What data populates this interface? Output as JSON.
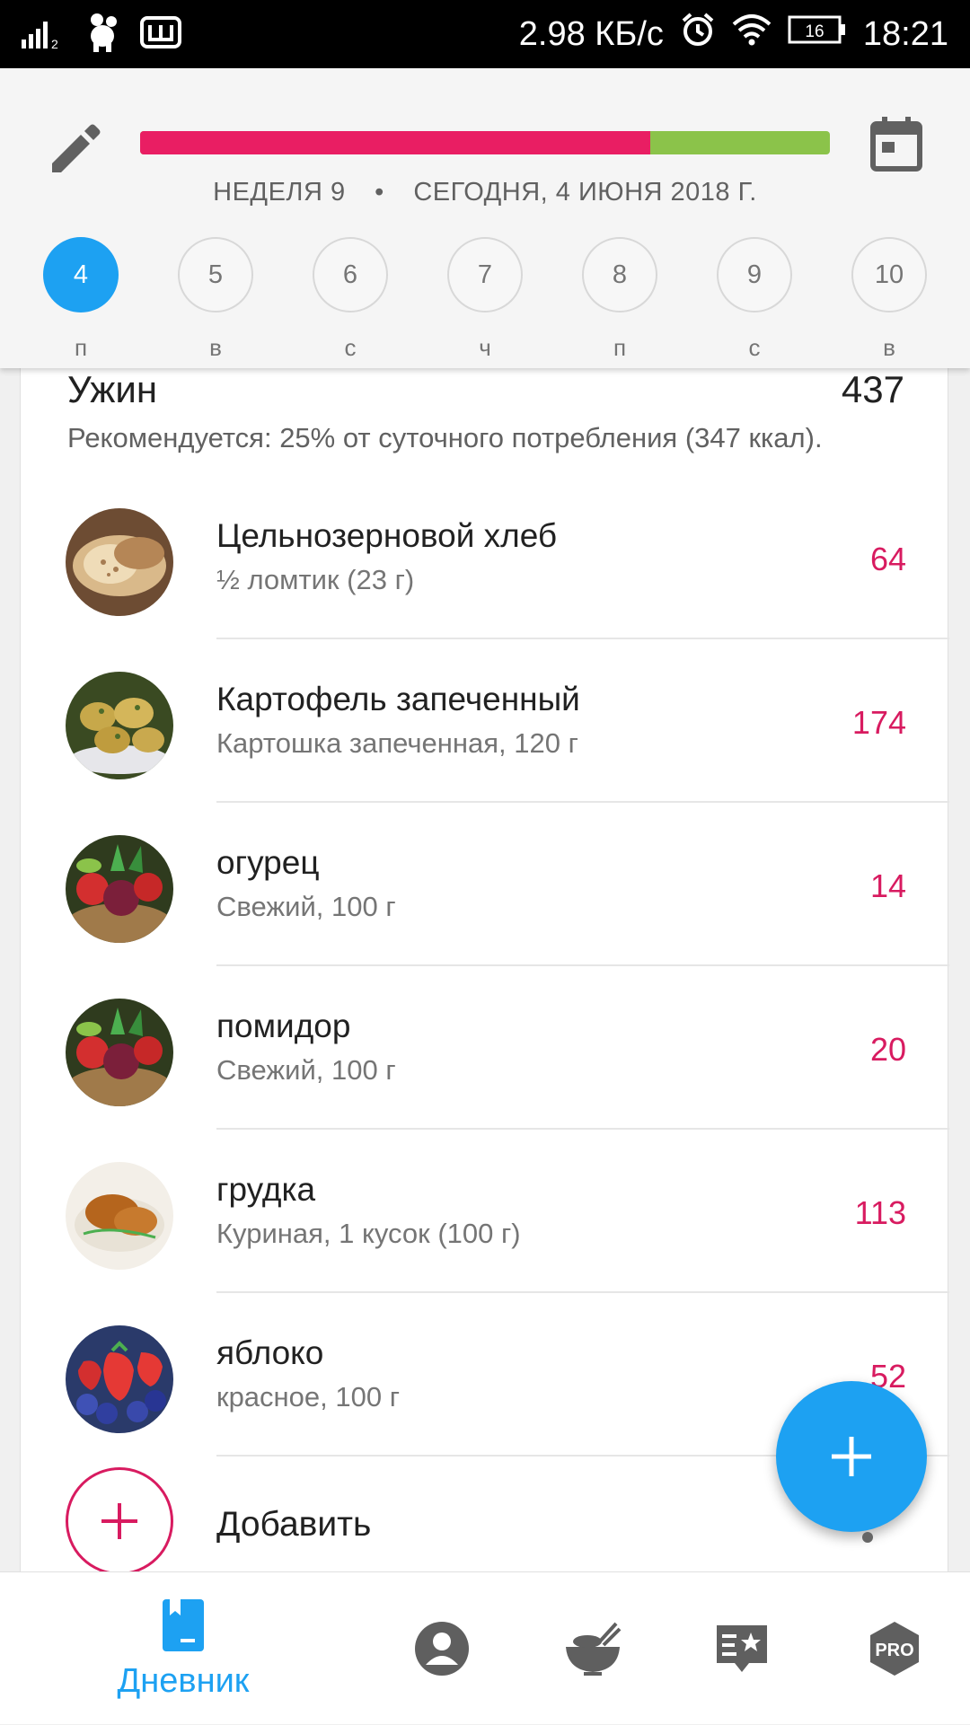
{
  "status_bar": {
    "net_speed": "2.98 КБ/с",
    "battery": "16",
    "time": "18:21",
    "sim_label": "2"
  },
  "header": {
    "progress_fraction": 0.74,
    "week_label": "НЕДЕЛЯ 9",
    "separator": "•",
    "date_label": "СЕГОДНЯ, 4 ИЮНЯ 2018 Г.",
    "days": [
      {
        "num": "4",
        "wd": "п",
        "active": true
      },
      {
        "num": "5",
        "wd": "в",
        "active": false
      },
      {
        "num": "6",
        "wd": "с",
        "active": false
      },
      {
        "num": "7",
        "wd": "ч",
        "active": false
      },
      {
        "num": "8",
        "wd": "п",
        "active": false
      },
      {
        "num": "9",
        "wd": "с",
        "active": false
      },
      {
        "num": "10",
        "wd": "в",
        "active": false
      }
    ]
  },
  "meal": {
    "title": "Ужин",
    "total": "437",
    "recommendation": "Рекомендуется: 25% от суточного потребления (347 ккал).",
    "items": [
      {
        "name": "Цельнозерновой хлеб",
        "desc": "½ ломтик (23 г)",
        "kcal": "64"
      },
      {
        "name": "Картофель  запеченный",
        "desc": "Картошка  запеченная, 120 г",
        "kcal": "174"
      },
      {
        "name": "огурец",
        "desc": "Свежий, 100 г",
        "kcal": "14"
      },
      {
        "name": "помидор",
        "desc": "Свежий, 100 г",
        "kcal": "20"
      },
      {
        "name": "грудка",
        "desc": "Куриная, 1 кусок (100 г)",
        "kcal": "113"
      },
      {
        "name": "яблоко",
        "desc": "красное, 100 г",
        "kcal": "52"
      }
    ],
    "add_label": "Добавить"
  },
  "bottom_nav": {
    "diary_label": "Дневник",
    "pro_label": "PRO"
  },
  "colors": {
    "accent": "#1da1f2",
    "calories": "#d81b60",
    "progress_over": "#e91e63",
    "progress_rest": "#8bc34a"
  }
}
